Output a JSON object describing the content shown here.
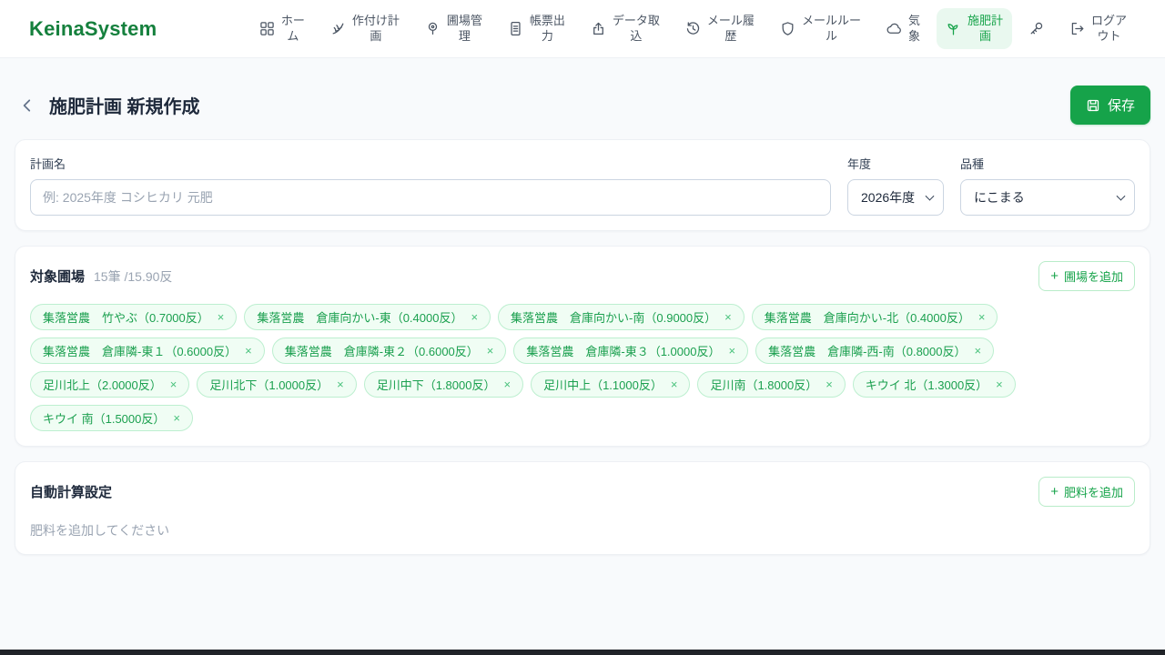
{
  "colors": {
    "accent": "#16a34a",
    "accent_light": "#e9f8ef",
    "chip_bg": "#f0fdf4",
    "chip_border": "#bdefd0"
  },
  "brand": "KeinaSystem",
  "nav": {
    "items": [
      {
        "id": "home",
        "icon": "grid-icon",
        "label": "ホー\nム",
        "active": false
      },
      {
        "id": "planting-plan",
        "icon": "wheat-icon",
        "label": "作付け計\n画",
        "active": false
      },
      {
        "id": "field-management",
        "icon": "geo-pin-icon",
        "label": "圃場管\n理",
        "active": false
      },
      {
        "id": "report-output",
        "icon": "document-icon",
        "label": "帳票出\n力",
        "active": false
      },
      {
        "id": "data-import",
        "icon": "upload-icon",
        "label": "データ取\n込",
        "active": false
      },
      {
        "id": "mail-history",
        "icon": "clock-history-icon",
        "label": "メール履\n歴",
        "active": false
      },
      {
        "id": "mail-rules",
        "icon": "shield-icon",
        "label": "メールルー\nル",
        "active": false
      },
      {
        "id": "weather",
        "icon": "cloud-icon",
        "label": "気\n象",
        "active": false
      },
      {
        "id": "fertilizer-plan",
        "icon": "sprout-icon",
        "label": "施肥計\n画",
        "active": true
      },
      {
        "id": "api-key",
        "icon": "key-icon",
        "label": "",
        "active": false
      },
      {
        "id": "logout",
        "icon": "logout-icon",
        "label": "ログア\nウト",
        "active": false
      }
    ]
  },
  "page": {
    "title": "施肥計画 新規作成",
    "save_label": "保存"
  },
  "form": {
    "plan_name": {
      "label": "計画名",
      "value": "",
      "placeholder": "例: 2025年度 コシヒカリ 元肥"
    },
    "year": {
      "label": "年度",
      "value": "2026年度"
    },
    "variety": {
      "label": "品種",
      "value": "にこまる"
    }
  },
  "fields_section": {
    "title": "対象圃場",
    "count": "15筆 /15.90反",
    "add_button": {
      "plus": "+",
      "label": "圃場を追加"
    },
    "chip_close": "×",
    "chips": [
      "集落営農　竹やぶ（0.7000反）",
      "集落営農　倉庫向かい-東（0.4000反）",
      "集落営農　倉庫向かい-南（0.9000反）",
      "集落営農　倉庫向かい-北（0.4000反）",
      "集落営農　倉庫隣-東１（0.6000反）",
      "集落営農　倉庫隣-東２（0.6000反）",
      "集落営農　倉庫隣-東３（1.0000反）",
      "集落営農　倉庫隣-西-南（0.8000反）",
      "足川北上（2.0000反）",
      "足川北下（1.0000反）",
      "足川中下（1.8000反）",
      "足川中上（1.1000反）",
      "足川南（1.8000反）",
      "キウイ 北（1.3000反）",
      "キウイ 南（1.5000反）"
    ]
  },
  "auto_calc_section": {
    "title": "自動計算設定",
    "add_button": {
      "plus": "+",
      "label": "肥料を追加"
    },
    "empty_text": "肥料を追加してください"
  }
}
